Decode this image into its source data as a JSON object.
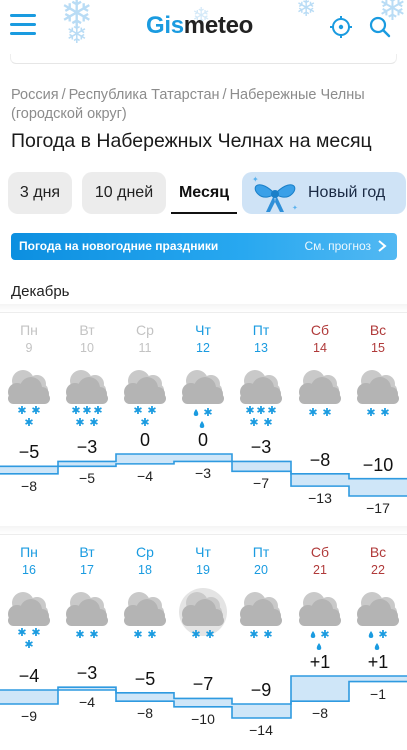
{
  "header": {
    "logo_part1": "Gis",
    "logo_part2": "meteo",
    "menu_icon": "hamburger-icon",
    "location_icon": "crosshair-icon",
    "search_icon": "search-icon"
  },
  "breadcrumb": {
    "items": [
      "Россия",
      "Республика Татарстан",
      "Набережные Челны (городской округ)"
    ],
    "separator": "/"
  },
  "page_title": "Погода в Набережных Челнах на месяц",
  "tabs": [
    {
      "label": "3 дня",
      "active": false
    },
    {
      "label": "10 дней",
      "active": false
    },
    {
      "label": "Месяц",
      "active": true
    },
    {
      "label": "Новый год",
      "active": false,
      "icon": "gift-bow-icon"
    }
  ],
  "banner": {
    "text": "Погода на новогодние праздники",
    "link": "См. прогноз"
  },
  "month_label": "Декабрь",
  "colors": {
    "accent": "#1a9be0",
    "weekend": "#b03a3a",
    "past": "#c3c3c3",
    "band_fill": "#cfe6f8",
    "band_line": "#2f9ae0"
  },
  "weeks": [
    {
      "days": [
        {
          "name": "Пн",
          "date": "9",
          "state": "past",
          "icon": "cloud-snow-icon",
          "precip": "snow2",
          "max": "−5",
          "min": "−8"
        },
        {
          "name": "Вт",
          "date": "10",
          "state": "past",
          "icon": "cloud-snow-icon",
          "precip": "snow3",
          "max": "−3",
          "min": "−5"
        },
        {
          "name": "Ср",
          "date": "11",
          "state": "past",
          "icon": "cloud-snow-icon",
          "precip": "snow2",
          "max": "0",
          "min": "−4"
        },
        {
          "name": "Чт",
          "date": "12",
          "state": "weekday",
          "icon": "cloud-sleet-icon",
          "precip": "sleet",
          "max": "0",
          "min": "−3"
        },
        {
          "name": "Пт",
          "date": "13",
          "state": "weekday",
          "icon": "cloud-snow-icon",
          "precip": "snow3",
          "max": "−3",
          "min": "−7"
        },
        {
          "name": "Сб",
          "date": "14",
          "state": "weekend",
          "icon": "cloud-snow-icon",
          "precip": "snow1",
          "max": "−8",
          "min": "−13"
        },
        {
          "name": "Вс",
          "date": "15",
          "state": "weekend",
          "icon": "cloud-snow-icon",
          "precip": "snow1",
          "max": "−10",
          "min": "−17"
        }
      ],
      "max_values": [
        -5,
        -3,
        0,
        0,
        -3,
        -8,
        -10
      ],
      "min_values": [
        -8,
        -5,
        -4,
        -3,
        -7,
        -13,
        -17
      ]
    },
    {
      "days": [
        {
          "name": "Пн",
          "date": "16",
          "state": "weekday",
          "icon": "cloud-snow-icon",
          "precip": "snow2",
          "max": "−4",
          "min": "−9"
        },
        {
          "name": "Вт",
          "date": "17",
          "state": "weekday",
          "icon": "cloud-snow-icon",
          "precip": "snow1",
          "max": "−3",
          "min": "−4"
        },
        {
          "name": "Ср",
          "date": "18",
          "state": "weekday",
          "icon": "cloud-snow-icon",
          "precip": "snow1",
          "max": "−5",
          "min": "−8"
        },
        {
          "name": "Чт",
          "date": "19",
          "state": "weekday",
          "icon": "cloud-snow-icon",
          "precip": "snow1",
          "max": "−7",
          "min": "−10",
          "highlight": true
        },
        {
          "name": "Пт",
          "date": "20",
          "state": "weekday",
          "icon": "cloud-snow-icon",
          "precip": "snow1",
          "max": "−9",
          "min": "−14"
        },
        {
          "name": "Сб",
          "date": "21",
          "state": "weekend",
          "icon": "cloud-sleet-icon",
          "precip": "sleet",
          "max": "+1",
          "min": "−8"
        },
        {
          "name": "Вс",
          "date": "22",
          "state": "weekend",
          "icon": "cloud-sleet-icon",
          "precip": "sleet",
          "max": "+1",
          "min": "−1"
        }
      ],
      "max_values": [
        -4,
        -3,
        -5,
        -7,
        -9,
        1,
        1
      ],
      "min_values": [
        -9,
        -4,
        -8,
        -10,
        -14,
        -8,
        -1
      ]
    }
  ]
}
